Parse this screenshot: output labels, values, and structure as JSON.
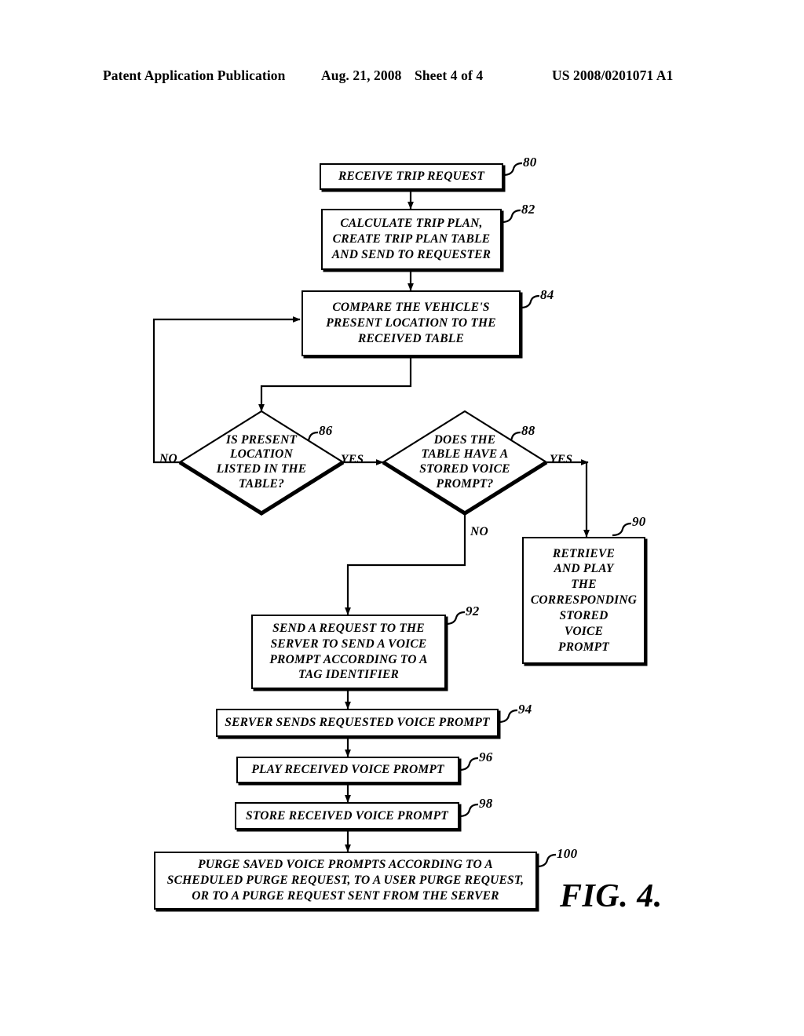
{
  "header": {
    "publication": "Patent Application Publication",
    "date": "Aug. 21, 2008",
    "sheet": "Sheet 4 of 4",
    "patent_number": "US 2008/0201071 A1"
  },
  "figure": {
    "caption": "FIG. 4.",
    "nodes": {
      "n80": {
        "ref": "80",
        "text": "RECEIVE TRIP REQUEST"
      },
      "n82": {
        "ref": "82",
        "text": "CALCULATE TRIP PLAN,\nCREATE TRIP PLAN TABLE\nAND SEND TO REQUESTER"
      },
      "n84": {
        "ref": "84",
        "text": "COMPARE THE VEHICLE'S\nPRESENT LOCATION TO THE\nRECEIVED TABLE"
      },
      "n86": {
        "ref": "86",
        "text": "IS PRESENT\nLOCATION\nLISTED IN THE\nTABLE?"
      },
      "n88": {
        "ref": "88",
        "text": "DOES THE\nTABLE HAVE A\nSTORED VOICE\nPROMPT?"
      },
      "n90": {
        "ref": "90",
        "text": "RETRIEVE\nAND PLAY\nTHE\nCORRESPONDING\nSTORED\nVOICE\nPROMPT"
      },
      "n92": {
        "ref": "92",
        "text": "SEND A REQUEST TO THE\nSERVER TO SEND A VOICE\nPROMPT ACCORDING TO A\nTAG IDENTIFIER"
      },
      "n94": {
        "ref": "94",
        "text": "SERVER SENDS REQUESTED VOICE PROMPT"
      },
      "n96": {
        "ref": "96",
        "text": "PLAY RECEIVED VOICE PROMPT"
      },
      "n98": {
        "ref": "98",
        "text": "STORE RECEIVED VOICE PROMPT"
      },
      "n100": {
        "ref": "100",
        "text": "PURGE SAVED VOICE PROMPTS ACCORDING TO A\nSCHEDULED PURGE REQUEST, TO A USER PURGE REQUEST,\nOR TO A PURGE REQUEST SENT FROM THE SERVER"
      }
    },
    "edge_labels": {
      "d86_no": "NO",
      "d86_yes": "YES",
      "d88_yes": "YES",
      "d88_no": "NO"
    }
  },
  "chart_data": {
    "type": "diagram",
    "title": "FIG. 4.",
    "nodes": [
      {
        "id": "80",
        "shape": "process",
        "label": "RECEIVE TRIP REQUEST"
      },
      {
        "id": "82",
        "shape": "process",
        "label": "CALCULATE TRIP PLAN, CREATE TRIP PLAN TABLE AND SEND TO REQUESTER"
      },
      {
        "id": "84",
        "shape": "process",
        "label": "COMPARE THE VEHICLE'S PRESENT LOCATION TO THE RECEIVED TABLE"
      },
      {
        "id": "86",
        "shape": "decision",
        "label": "IS PRESENT LOCATION LISTED IN THE TABLE?"
      },
      {
        "id": "88",
        "shape": "decision",
        "label": "DOES THE TABLE HAVE A STORED VOICE PROMPT?"
      },
      {
        "id": "90",
        "shape": "process",
        "label": "RETRIEVE AND PLAY THE CORRESPONDING STORED VOICE PROMPT"
      },
      {
        "id": "92",
        "shape": "process",
        "label": "SEND A REQUEST TO THE SERVER TO SEND A VOICE PROMPT ACCORDING TO A TAG IDENTIFIER"
      },
      {
        "id": "94",
        "shape": "process",
        "label": "SERVER SENDS REQUESTED VOICE PROMPT"
      },
      {
        "id": "96",
        "shape": "process",
        "label": "PLAY RECEIVED VOICE PROMPT"
      },
      {
        "id": "98",
        "shape": "process",
        "label": "STORE RECEIVED VOICE PROMPT"
      },
      {
        "id": "100",
        "shape": "process",
        "label": "PURGE SAVED VOICE PROMPTS ACCORDING TO A SCHEDULED PURGE REQUEST, TO A USER PURGE REQUEST, OR TO A PURGE REQUEST SENT FROM THE SERVER"
      }
    ],
    "edges": [
      {
        "from": "80",
        "to": "82",
        "label": ""
      },
      {
        "from": "82",
        "to": "84",
        "label": ""
      },
      {
        "from": "84",
        "to": "86",
        "label": ""
      },
      {
        "from": "86",
        "to": "84",
        "label": "NO"
      },
      {
        "from": "86",
        "to": "88",
        "label": "YES"
      },
      {
        "from": "88",
        "to": "90",
        "label": "YES"
      },
      {
        "from": "88",
        "to": "92",
        "label": "NO"
      },
      {
        "from": "92",
        "to": "94",
        "label": ""
      },
      {
        "from": "94",
        "to": "96",
        "label": ""
      },
      {
        "from": "96",
        "to": "98",
        "label": ""
      },
      {
        "from": "98",
        "to": "100",
        "label": ""
      }
    ]
  }
}
